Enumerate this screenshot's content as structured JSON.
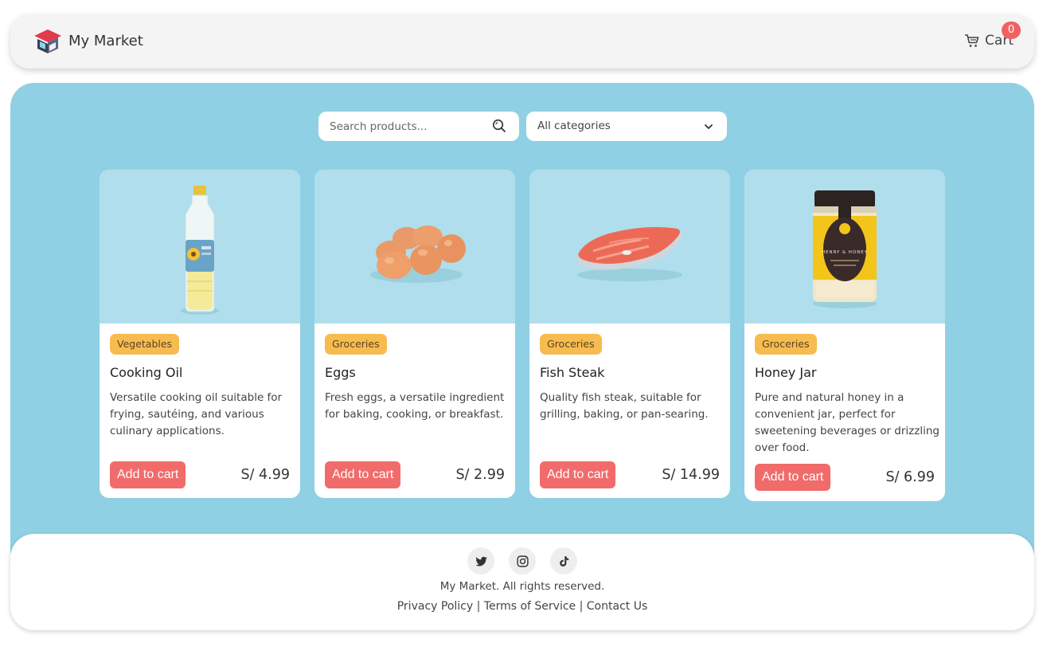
{
  "header": {
    "brand": "My Market",
    "cart_label": "Cart",
    "cart_count": "0",
    "logo_icon": "store-icon",
    "cart_icon": "cart-icon"
  },
  "filters": {
    "search_placeholder": "Search products...",
    "category_selected": "All categories"
  },
  "products": [
    {
      "category": "Vegetables",
      "name": "Cooking Oil",
      "description": "Versatile cooking oil suitable for frying, sautéing, and various culinary applications.",
      "button": "Add to cart",
      "price": "S/ 4.99"
    },
    {
      "category": "Groceries",
      "name": "Eggs",
      "description": "Fresh eggs, a versatile ingredient for baking, cooking, or breakfast.",
      "button": "Add to cart",
      "price": "S/ 2.99"
    },
    {
      "category": "Groceries",
      "name": "Fish Steak",
      "description": "Quality fish steak, suitable for grilling, baking, or pan-searing.",
      "button": "Add to cart",
      "price": "S/ 14.99"
    },
    {
      "category": "Groceries",
      "name": "Honey Jar",
      "description": "Pure and natural honey in a convenient jar, perfect for sweetening beverages or drizzling over food.",
      "button": "Add to cart",
      "price": "S/ 6.99",
      "label_text": "HENRY & HONEY"
    }
  ],
  "footer": {
    "social": [
      "twitter-icon",
      "instagram-icon",
      "tiktok-icon"
    ],
    "copyright": "My Market. All rights reserved.",
    "links": [
      "Privacy Policy",
      "Terms of Service",
      "Contact Us"
    ],
    "separator": "|"
  },
  "colors": {
    "main_bg": "#8fd0e4",
    "badge": "#f7bb4f",
    "button": "#f26b6b"
  }
}
